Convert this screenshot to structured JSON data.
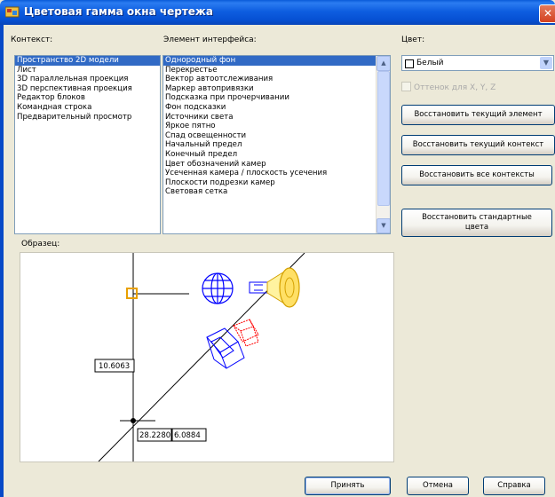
{
  "window": {
    "title": "Цветовая гамма окна чертежа",
    "close_glyph": "✕"
  },
  "context": {
    "label": "Контекст:",
    "items": [
      "Пространство 2D модели",
      "Лист",
      "3D параллельная проекция",
      "3D перспективная проекция",
      "Редактор блоков",
      "Командная строка",
      "Предварительный просмотр"
    ],
    "selected_index": 0
  },
  "interface_element": {
    "label": "Элемент интерфейса:",
    "items": [
      "Однородный фон",
      "Перекрестье",
      "Вектор автоотслеживания",
      "Маркер автопривязки",
      "Подсказка при прочерчивании",
      "Фон подсказки",
      "Источники света",
      "Яркое пятно",
      "Спад освещенности",
      "Начальный предел",
      "Конечный предел",
      "Цвет обозначений камер",
      "Усеченная камера / плоскость усечения",
      "Плоскости подрезки камер",
      "Световая сетка"
    ],
    "selected_index": 0
  },
  "color": {
    "label": "Цвет:",
    "value": "Белый",
    "swatch": "#ffffff"
  },
  "tint_checkbox": {
    "label": "Оттенок для X, Y, Z",
    "checked": false,
    "enabled": false
  },
  "buttons": {
    "restore_element": "Восстановить текущий элемент",
    "restore_context": "Восстановить текущий контекст",
    "restore_all": "Восстановить все контексты",
    "restore_defaults": "Восстановить стандартные цвета",
    "apply": "Принять",
    "cancel": "Отмена",
    "help": "Справка"
  },
  "preview": {
    "label": "Образец:",
    "dim_vertical": "10.6063",
    "dim_x": "28.2280",
    "dim_y": "6.0884"
  },
  "colors": {
    "accent": "#316ac5",
    "titlebar": "#0a5bd9",
    "marker": "#e8a000",
    "camera": "#0000ff",
    "light": "#ffcc00"
  },
  "icons": [
    "autocad-app-icon",
    "close-icon",
    "scroll-up-icon",
    "scroll-down-icon",
    "chevron-down-icon"
  ]
}
